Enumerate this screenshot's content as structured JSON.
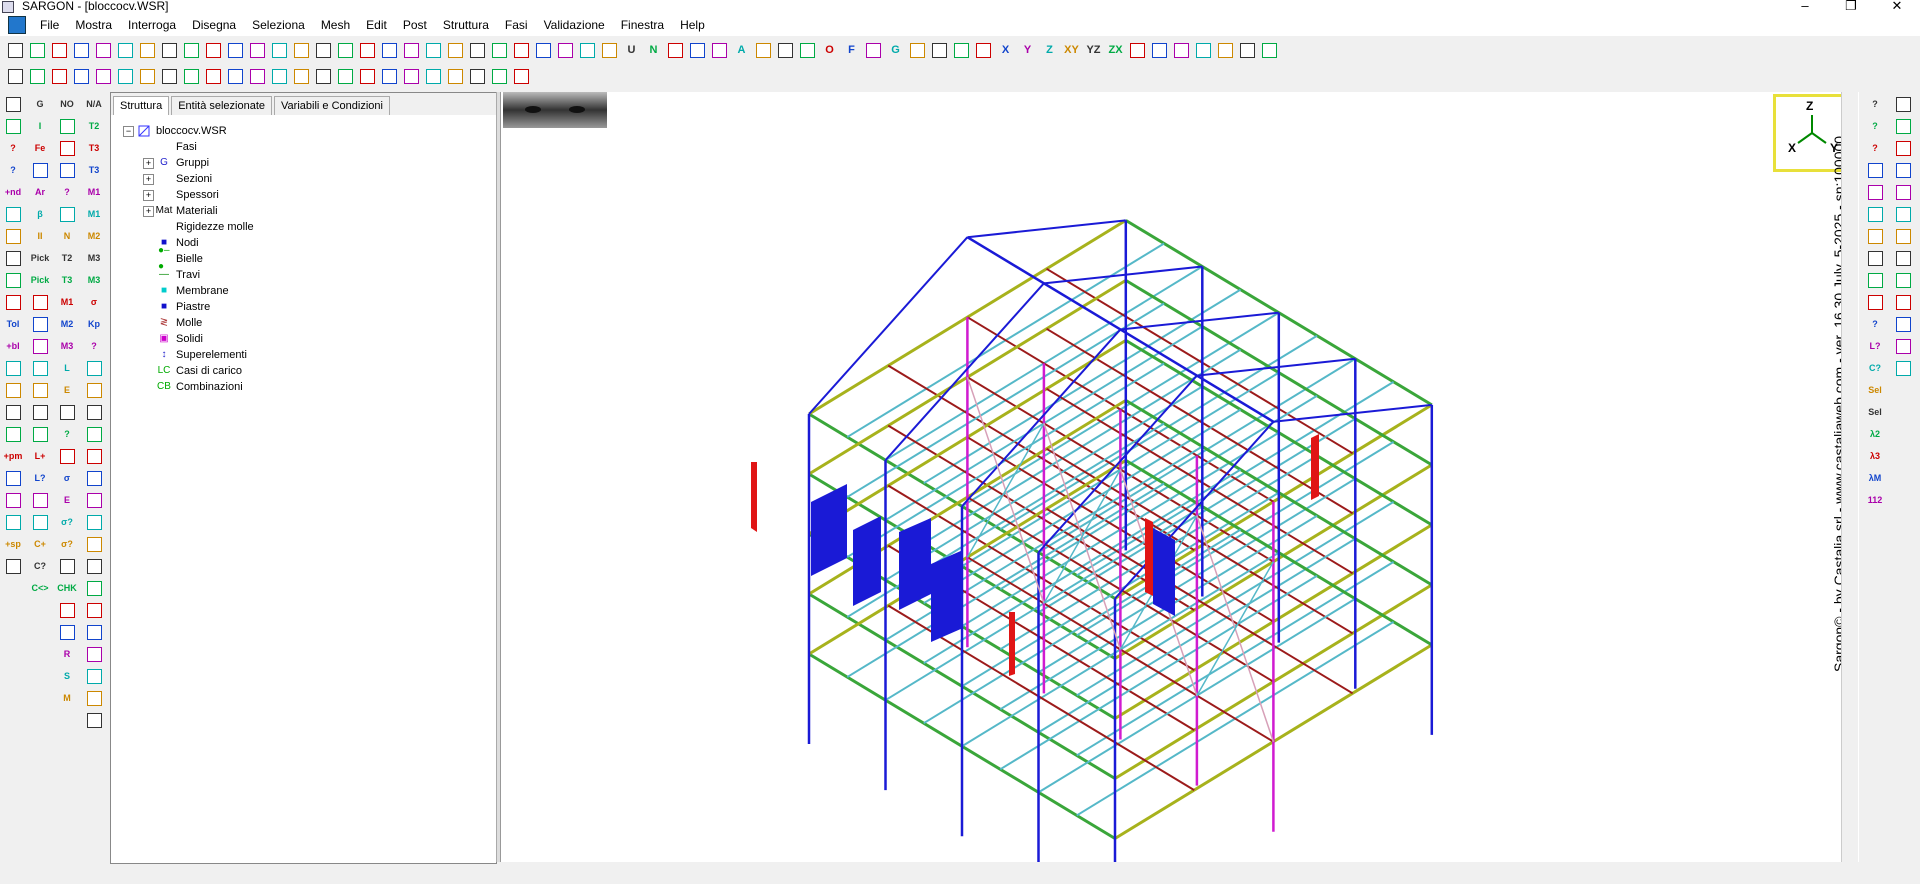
{
  "window": {
    "title": "SARGON - [bloccocv.WSR]",
    "minimize": "–",
    "maximize": "❐",
    "close": "✕"
  },
  "menu": [
    "File",
    "Mostra",
    "Interroga",
    "Disegna",
    "Seleziona",
    "Mesh",
    "Edit",
    "Post",
    "Struttura",
    "Fasi",
    "Validazione",
    "Finestra",
    "Help"
  ],
  "toolbar1": [
    "",
    "",
    "",
    "",
    "",
    "",
    "",
    "",
    "",
    "",
    "",
    "",
    "",
    "",
    "",
    "",
    "",
    "",
    "",
    "",
    "",
    "",
    "",
    "",
    "",
    "",
    "",
    "",
    "U",
    "N",
    "",
    "",
    "",
    "A",
    "",
    "",
    "",
    "O",
    "F",
    "",
    "G",
    "",
    "",
    "",
    "",
    "X",
    "Y",
    "Z",
    "XY",
    "YZ",
    "ZX",
    "",
    "",
    "",
    "",
    "",
    "",
    ""
  ],
  "toolbar2": [
    "",
    "",
    "",
    "",
    "",
    "",
    "",
    "",
    "",
    "",
    "",
    "",
    "",
    "",
    "",
    "",
    "",
    "",
    "",
    "",
    "",
    "",
    "",
    ""
  ],
  "left_tool_a": [
    "",
    "",
    "?",
    "?",
    "+nd",
    "",
    "",
    "",
    "",
    "",
    "Tol",
    "+bl",
    "",
    "",
    "",
    "",
    "+pm",
    "",
    "",
    "",
    "+sp",
    ""
  ],
  "left_tool_b": [
    "G",
    "I",
    "Fe",
    "",
    "Ar",
    "β",
    "II",
    "Pick",
    "Pick",
    "",
    "",
    "",
    "",
    "",
    "",
    "",
    "L+",
    "L?",
    "",
    "",
    "C+",
    "C?",
    "C<>"
  ],
  "left_tool_c": [
    "NO",
    "",
    "",
    "",
    "?",
    "",
    "N",
    "T2",
    "T3",
    "M1",
    "M2",
    "M3",
    "L",
    "E",
    "",
    "?",
    "",
    "σ",
    "E",
    "σ?",
    "σ?",
    "",
    "CHK",
    "",
    "",
    "R",
    "S",
    "M"
  ],
  "left_tool_d": [
    "N/A",
    "T2",
    "T3",
    "T3",
    "M1",
    "M1",
    "M2",
    "M3",
    "M3",
    "σ",
    "Kp",
    "?",
    "",
    "",
    "",
    "",
    "",
    "",
    "",
    "",
    "",
    "",
    "",
    "",
    "",
    "",
    "",
    "",
    ""
  ],
  "panel": {
    "tabs": [
      "Struttura",
      "Entità selezionate",
      "Variabili e Condizioni"
    ],
    "root": "bloccocv.WSR",
    "items": [
      "Fasi",
      "Gruppi",
      "Sezioni",
      "Spessori",
      "Materiali",
      "Rigidezze molle",
      "Nodi",
      "Bielle",
      "Travi",
      "Membrane",
      "Piastre",
      "Molle",
      "Solidi",
      "Superelementi",
      "Casi di carico",
      "Combinazioni"
    ],
    "item_icons": [
      "",
      "G",
      "",
      "",
      "Mat",
      "",
      "■",
      "●–●",
      "—",
      "■",
      "■",
      "≷",
      "▣",
      "↕",
      "LC",
      "CB"
    ]
  },
  "axis_box": {
    "z": "Z",
    "x": "X",
    "y": "Y"
  },
  "viewport_label": "Sargon© - by Castalia srl - www.castaliaweb.com - ver. 16.30 July, 5-2025 - sn:100000",
  "right_tool_a": [
    "?",
    "?",
    "?",
    "",
    "",
    "",
    "",
    "",
    "",
    "",
    "?",
    "L?",
    "C?",
    "Sel",
    "Sel",
    "λ2",
    "λ3",
    "λM",
    "112"
  ],
  "right_tool_b": [
    "",
    "",
    "",
    "",
    "",
    "",
    "",
    "",
    "",
    "",
    "",
    "",
    ""
  ],
  "colors": {
    "blue": "#1a1ad6",
    "green": "#3aa63a",
    "darkred": "#9c1b1b",
    "cyan": "#55b8c8",
    "magenta": "#d01bd0",
    "olive": "#a7b21c",
    "red": "#e01515",
    "pink": "#d7a0b8",
    "axis_border": "#e8e03a"
  }
}
